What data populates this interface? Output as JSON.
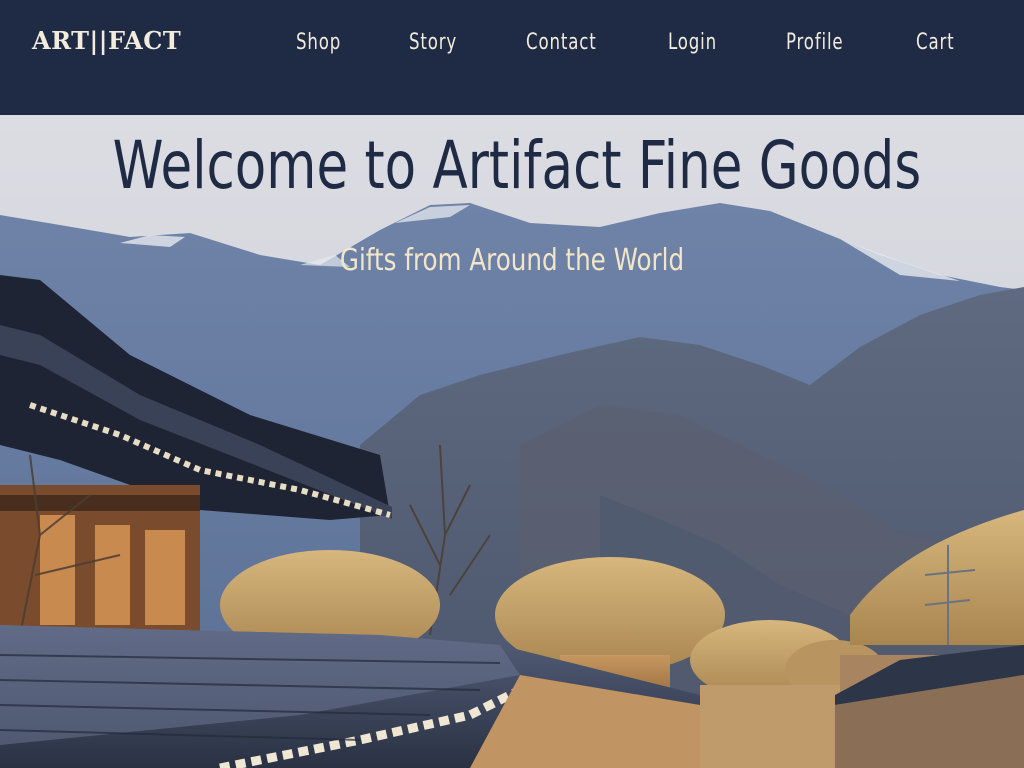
{
  "brand": {
    "logo_text": "ART||FACT"
  },
  "nav": {
    "items": [
      {
        "label": "Shop"
      },
      {
        "label": "Story"
      },
      {
        "label": "Contact"
      },
      {
        "label": "Login"
      },
      {
        "label": "Profile"
      },
      {
        "label": "Cart"
      }
    ]
  },
  "hero": {
    "title": "Welcome to Artifact Fine Goods",
    "subtitle": "Gifts from Around the World",
    "background_image": "mountain-village-photo"
  },
  "colors": {
    "header_bg": "#1f2b45",
    "nav_text": "#f3ecdd",
    "hero_title": "#1f2b45",
    "hero_subtitle": "#f2e6c8"
  }
}
